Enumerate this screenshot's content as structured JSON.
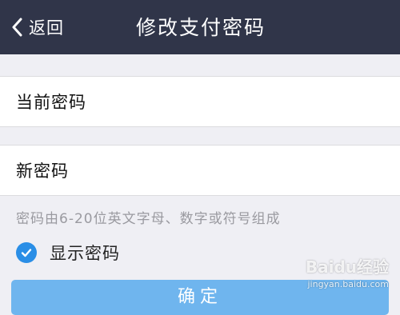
{
  "nav": {
    "back_label": "返回",
    "title": "修改支付密码"
  },
  "form": {
    "current_password": {
      "label": "当前密码",
      "value": "",
      "placeholder": ""
    },
    "new_password": {
      "label": "新密码",
      "value": "",
      "placeholder": ""
    },
    "hint": "密码由6-20位英文字母、数字或符号组成",
    "show_password": {
      "label": "显示密码",
      "checked": true
    },
    "confirm_label": "确定"
  },
  "watermark": {
    "logo": "Baidu经验",
    "site": "jingyan.baidu.com"
  },
  "colors": {
    "nav_bg": "#303549",
    "page_bg": "#efeff4",
    "accent": "#2a8ee6",
    "button_bg": "#6fb5ee",
    "hint_text": "#9a9aa0"
  },
  "icons": {
    "back": "chevron-left-icon",
    "checkbox": "checkmark-icon"
  }
}
